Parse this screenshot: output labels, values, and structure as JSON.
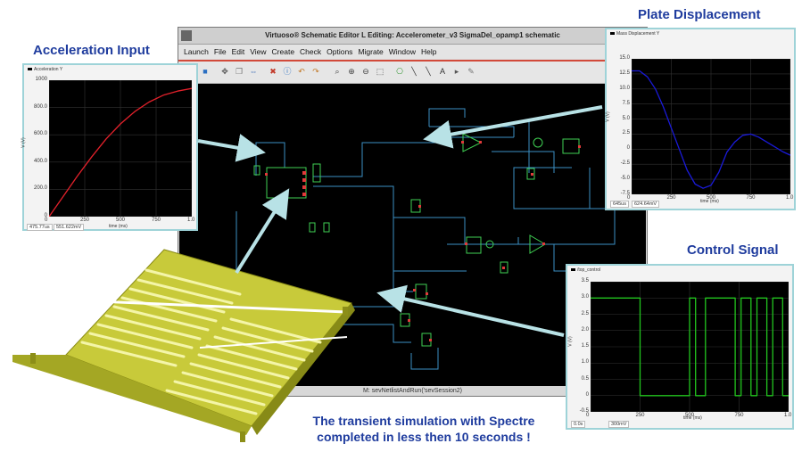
{
  "labels": {
    "acceleration_input": "Acceleration Input",
    "plate_displacement": "Plate Displacement",
    "control_signal": "Control Signal",
    "caption_line1": "The transient simulation with Spectre",
    "caption_line2": "completed in less then 10 seconds !"
  },
  "window": {
    "title": "Virtuoso® Schematic Editor L Editing: Accelerometer_v3 SigmaDel_opamp1 schematic",
    "menu": [
      "Launch",
      "File",
      "Edit",
      "View",
      "Create",
      "Check",
      "Options",
      "Migrate",
      "Window",
      "Help"
    ],
    "status": "M: sevNetlistAndRun('sevSession2)",
    "toolbar_icons": [
      "check-save-icon",
      "save-icon",
      "move-icon",
      "copy-icon",
      "stretch-icon",
      "delete-icon",
      "info-icon",
      "undo-icon",
      "redo-icon",
      "zoom-fit-icon",
      "zoom-in-icon",
      "zoom-out-icon",
      "zoom-area-icon",
      "instance-icon",
      "wire-icon",
      "wire-narrow-icon",
      "label-icon",
      "pin-icon",
      "note-icon"
    ]
  },
  "plots": {
    "acceleration": {
      "legend": "Acceleration Y",
      "ylabel": "V (V)",
      "xlabel": "time (ms)",
      "yticks": [
        "1000",
        "800.0",
        "600.0",
        "400.0",
        "200.0",
        "0"
      ],
      "xticks": [
        "0",
        "250",
        "500",
        "750",
        "1.0"
      ],
      "cursor": [
        "475.77us",
        "551.622mV"
      ],
      "color": "#e3212b"
    },
    "displacement": {
      "legend": "Mass Displacement Y",
      "ylabel": "V (V)",
      "xlabel": "time (ms)",
      "yticks": [
        "15.0",
        "12.5",
        "10.0",
        "7.5",
        "5.0",
        "2.5",
        "0",
        "-2.5",
        "-5.0",
        "-7.5"
      ],
      "xticks": [
        "0",
        "250",
        "500",
        "750",
        "1.0"
      ],
      "cursor": [
        "645us",
        "624.64mV"
      ],
      "color": "#1a1ad8"
    },
    "control": {
      "legend": "/top_control",
      "ylabel": "V (V)",
      "xlabel": "time (ms)",
      "yticks": [
        "3.5",
        "3.0",
        "2.5",
        "2.0",
        "1.5",
        "1.0",
        "0.5",
        "0",
        "-0.5"
      ],
      "xticks": [
        "0",
        "250",
        "500",
        "750",
        "1.0"
      ],
      "cursor": [
        "0.0s",
        "300mV"
      ],
      "color": "#22c51e"
    }
  },
  "chart_data": [
    {
      "type": "line",
      "legend": "Acceleration Y",
      "ylabel": "V (V)",
      "xlabel": "time (ms)",
      "xlim": [
        0,
        1.0
      ],
      "ylim": [
        0,
        1000
      ],
      "series": [
        {
          "name": "Acceleration Y",
          "x": [
            0,
            0.1,
            0.2,
            0.3,
            0.4,
            0.5,
            0.6,
            0.7,
            0.8,
            0.9,
            1.0
          ],
          "y": [
            0,
            150,
            300,
            440,
            570,
            680,
            770,
            840,
            890,
            920,
            940
          ]
        }
      ]
    },
    {
      "type": "line",
      "legend": "Mass Displacement Y",
      "ylabel": "V (V)",
      "xlabel": "time (ms)",
      "xlim": [
        0,
        1.0
      ],
      "ylim": [
        -7.5,
        15.0
      ],
      "series": [
        {
          "name": "Mass Displacement Y",
          "x": [
            0,
            0.05,
            0.1,
            0.15,
            0.2,
            0.25,
            0.3,
            0.35,
            0.4,
            0.45,
            0.5,
            0.55,
            0.6,
            0.65,
            0.7,
            0.75,
            0.8,
            0.85,
            0.9,
            0.95,
            1.0
          ],
          "y": [
            13.0,
            13.0,
            12.0,
            10.0,
            7.0,
            3.5,
            0,
            -3.5,
            -5.8,
            -6.5,
            -6.0,
            -3.8,
            -0.5,
            1.2,
            2.3,
            2.5,
            2.0,
            1.2,
            0.4,
            -0.4,
            -1.0
          ]
        }
      ]
    },
    {
      "type": "line",
      "legend": "/top_control",
      "ylabel": "V (V)",
      "xlabel": "time (ms)",
      "xlim": [
        0,
        1.0
      ],
      "ylim": [
        -0.5,
        3.5
      ],
      "series": [
        {
          "name": "/top_control",
          "x": [
            0,
            0.25,
            0.25,
            0.5,
            0.5,
            0.53,
            0.53,
            0.58,
            0.58,
            0.73,
            0.73,
            0.76,
            0.76,
            0.81,
            0.81,
            0.84,
            0.84,
            0.89,
            0.89,
            0.92,
            0.92,
            0.97,
            0.97,
            1.0
          ],
          "y": [
            3.0,
            3.0,
            0,
            0,
            3.0,
            3.0,
            0,
            0,
            3.0,
            3.0,
            0,
            0,
            3.0,
            3.0,
            0,
            0,
            3.0,
            3.0,
            0,
            0,
            3.0,
            3.0,
            0,
            0
          ]
        }
      ]
    }
  ]
}
